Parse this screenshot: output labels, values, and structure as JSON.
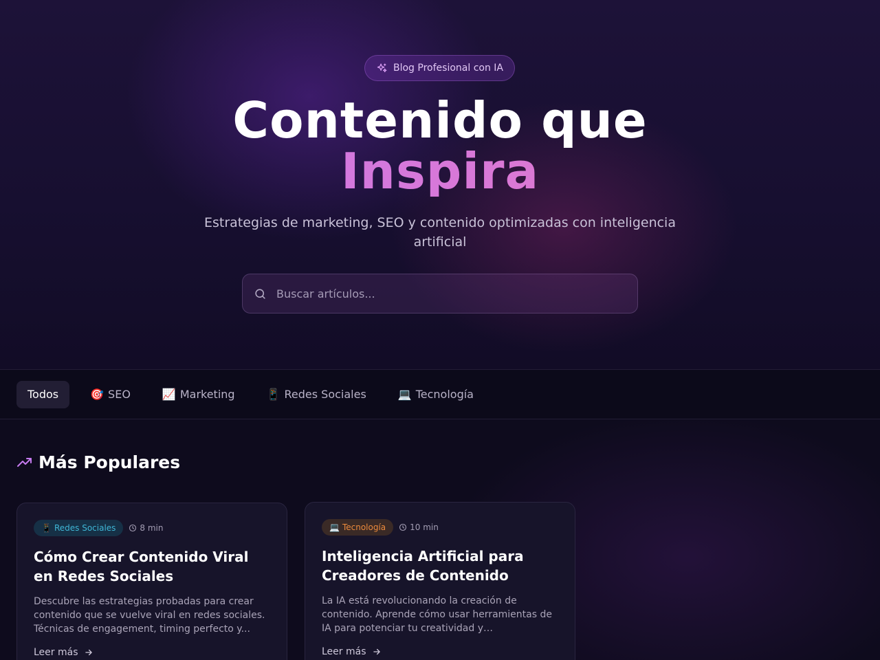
{
  "hero": {
    "badge": "Blog Profesional con IA",
    "title_line1": "Contenido que",
    "title_line2": "Inspira",
    "subtitle": "Estrategias de marketing, SEO y contenido optimizadas con inteligencia artificial",
    "search_placeholder": "Buscar artículos...",
    "search_value": ""
  },
  "categories": [
    {
      "icon": "",
      "label": "Todos",
      "active": true
    },
    {
      "icon": "🎯",
      "label": "SEO",
      "active": false
    },
    {
      "icon": "📈",
      "label": "Marketing",
      "active": false
    },
    {
      "icon": "📱",
      "label": "Redes Sociales",
      "active": false
    },
    {
      "icon": "💻",
      "label": "Tecnología",
      "active": false
    }
  ],
  "popular": {
    "title": "Más Populares",
    "cards": [
      {
        "tag_icon": "📱",
        "tag": "Redes Sociales",
        "read_time": "8 min",
        "title": "Cómo Crear Contenido Viral en Redes Sociales",
        "excerpt": "Descubre las estrategias probadas para crear contenido que se vuelve viral en redes sociales. Técnicas de engagement, timing perfecto y...",
        "more": "Leer más"
      },
      {
        "tag_icon": "💻",
        "tag": "Tecnología",
        "read_time": "10 min",
        "title": "Inteligencia Artificial para Creadores de Contenido",
        "excerpt": "La IA está revolucionando la creación de contenido. Aprende cómo usar herramientas de IA para potenciar tu creatividad y productividad...",
        "more": "Leer más"
      }
    ]
  },
  "colors": {
    "accent_purple": "#c678ee",
    "accent_pink": "#e878c4",
    "tag_social": "#3fb6d6",
    "tag_tech": "#ec8a3c"
  }
}
